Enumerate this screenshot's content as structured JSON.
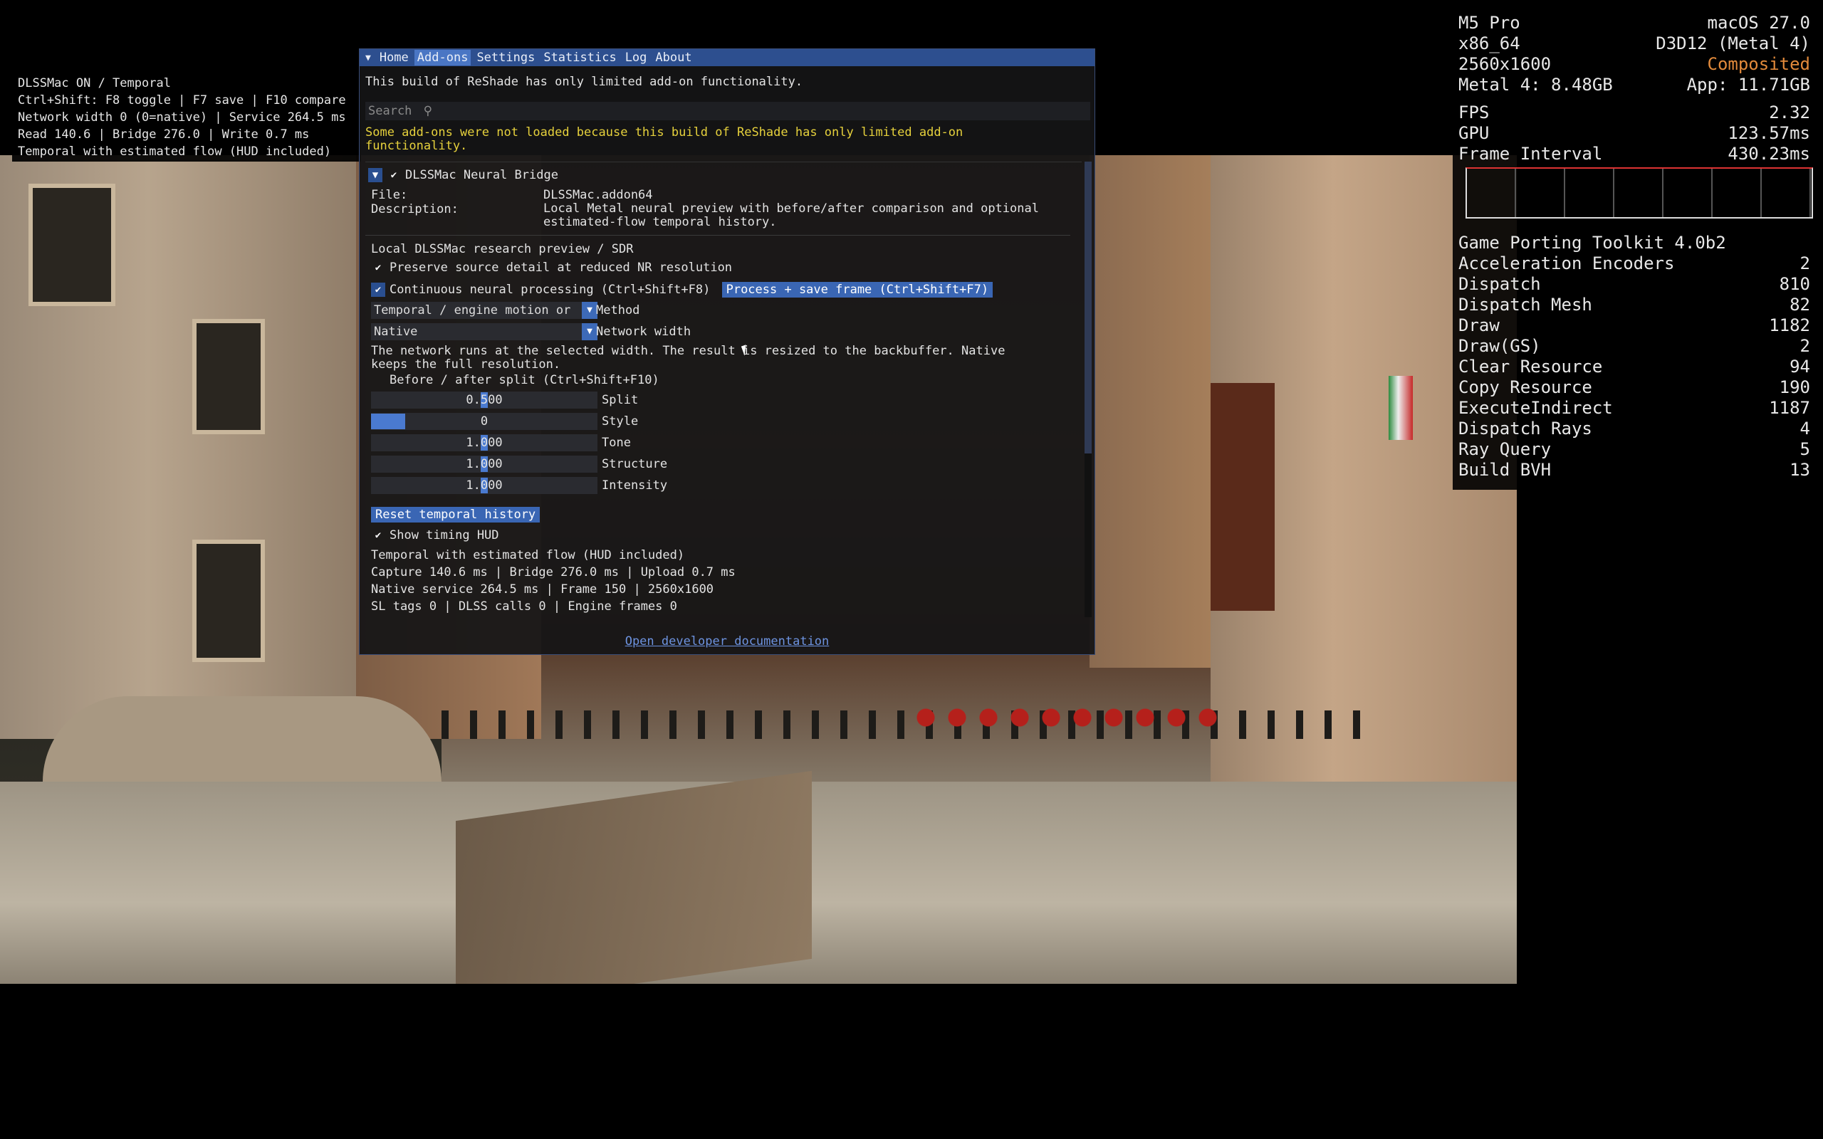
{
  "dlss_overlay": {
    "lines": [
      "DLSSMac ON / Temporal",
      "Ctrl+Shift: F8 toggle | F7 save | F10 compare",
      "Network width 0 (0=native) | Service 264.5 ms",
      "Read 140.6 | Bridge 276.0 | Write 0.7 ms",
      "Temporal with estimated flow (HUD included)"
    ]
  },
  "stats": {
    "device": "M5 Pro",
    "os": "macOS 27.0",
    "arch": "x86_64",
    "api": "D3D12 (Metal 4)",
    "resolution": "2560x1600",
    "mode": "Composited",
    "metal_mem": "Metal 4: 8.48GB",
    "app_mem": "App: 11.71GB",
    "fps_label": "FPS",
    "fps_value": "2.32",
    "gpu_label": "GPU",
    "gpu_value": "123.57ms",
    "frame_label": "Frame Interval",
    "frame_value": "430.23ms",
    "toolkit": "Game Porting Toolkit 4.0b2",
    "counters": [
      {
        "label": "Acceleration Encoders",
        "value": "2"
      },
      {
        "label": "Dispatch",
        "value": "810"
      },
      {
        "label": "Dispatch Mesh",
        "value": "82"
      },
      {
        "label": "Draw",
        "value": "1182"
      },
      {
        "label": "Draw(GS)",
        "value": "2"
      },
      {
        "label": "Clear Resource",
        "value": "94"
      },
      {
        "label": "Copy Resource",
        "value": "190"
      },
      {
        "label": "ExecuteIndirect",
        "value": "1187"
      },
      {
        "label": "Dispatch Rays",
        "value": "4"
      },
      {
        "label": "Ray Query",
        "value": "5"
      },
      {
        "label": "Build BVH",
        "value": "13"
      }
    ],
    "accent_color": "#e28a3b"
  },
  "reshade": {
    "tabs": [
      "Home",
      "Add-ons",
      "Settings",
      "Statistics",
      "Log",
      "About"
    ],
    "active_tab": "Add-ons",
    "notice": "This build of ReShade has only limited add-on functionality.",
    "search_placeholder": "Search",
    "warning_line1": "Some add-ons were not loaded because this build of ReShade has only limited add-on",
    "warning_line2": "functionality.",
    "addon": {
      "name": "DLSSMac Neural Bridge",
      "file_label": "File:",
      "file_value": "DLSSMac.addon64",
      "desc_label": "Description:",
      "desc_line1": "Local Metal neural preview with before/after comparison and optional",
      "desc_line2": "estimated-flow temporal history.",
      "section_title": "Local DLSSMac research preview / SDR",
      "preserve_label": "Preserve source detail at reduced NR resolution",
      "continuous_label": "Continuous neural processing (Ctrl+Shift+F8)",
      "process_button": "Process + save frame (Ctrl+Shift+F7)",
      "method_value": "Temporal / engine motion or",
      "method_label": "Method",
      "width_value": "Native",
      "width_label": "Network width",
      "note_line1": "The network runs at the selected width. The result is resized to the backbuffer. Native",
      "note_line2": "keeps the full resolution.",
      "split_toggle_label": "Before / after split (Ctrl+Shift+F10)",
      "sliders": [
        {
          "label": "Split",
          "value": "0.500",
          "fraction": 0.5,
          "kind": "grab"
        },
        {
          "label": "Style",
          "value": "0",
          "fraction": 0.15,
          "kind": "fill"
        },
        {
          "label": "Tone",
          "value": "1.000",
          "fraction": 0.5,
          "kind": "grab"
        },
        {
          "label": "Structure",
          "value": "1.000",
          "fraction": 0.5,
          "kind": "grab"
        },
        {
          "label": "Intensity",
          "value": "1.000",
          "fraction": 0.5,
          "kind": "grab"
        }
      ],
      "reset_button": "Reset temporal history",
      "show_hud_label": "Show timing HUD",
      "status_line1": "Temporal with estimated flow (HUD included)",
      "status_line2": "Capture 140.6 ms | Bridge 276.0 ms | Upload 0.7 ms",
      "status_line3": "Native service 264.5 ms | Frame 150 | 2560x1600",
      "status_line4": "SL tags 0 | DLSS calls 0 | Engine frames 0"
    },
    "doc_link": "Open developer documentation"
  }
}
